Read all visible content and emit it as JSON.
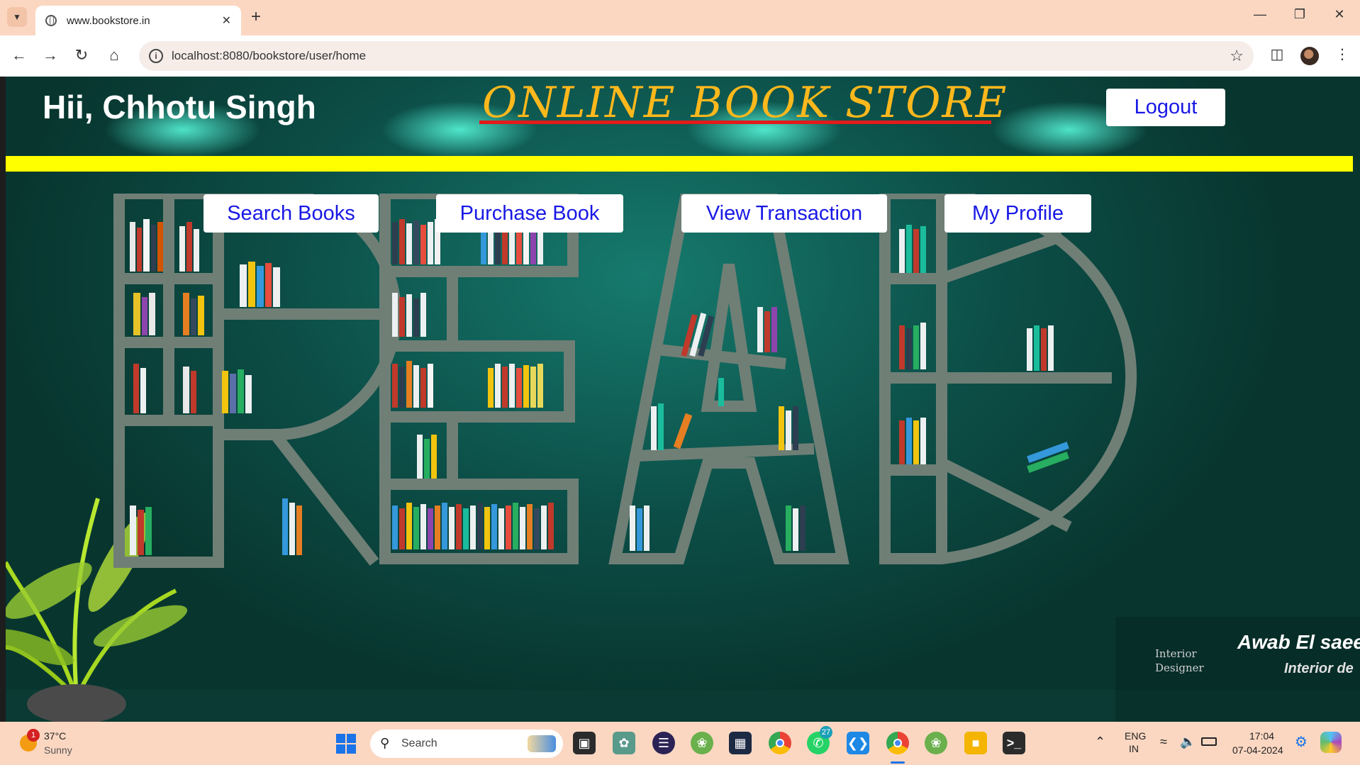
{
  "browser": {
    "tab_title": "www.bookstore.in",
    "url": "localhost:8080/bookstore/user/home"
  },
  "page": {
    "greeting": "Hii, Chhotu Singh",
    "store_title": "ONLINE BOOK STORE",
    "logout_label": "Logout",
    "nav": [
      {
        "label": "Search Books"
      },
      {
        "label": "Purchase Book"
      },
      {
        "label": "View Transaction"
      },
      {
        "label": "My Profile"
      }
    ],
    "watermark": {
      "name": "Awab El saee",
      "subtitle": "Interior de",
      "logo_text": "Interior Designer"
    }
  },
  "taskbar": {
    "weather": {
      "temp": "37°C",
      "condition": "Sunny",
      "badge": "1"
    },
    "search_placeholder": "Search",
    "whatsapp_badge": "27",
    "language": "ENG",
    "region": "IN",
    "time": "17:04",
    "date": "07-04-2024"
  },
  "colors": {
    "page_bg": "#0c4f48",
    "title": "#ffb81c",
    "underline": "#e21b1b",
    "banner": "#ffff00",
    "button_text": "#1818e6"
  }
}
